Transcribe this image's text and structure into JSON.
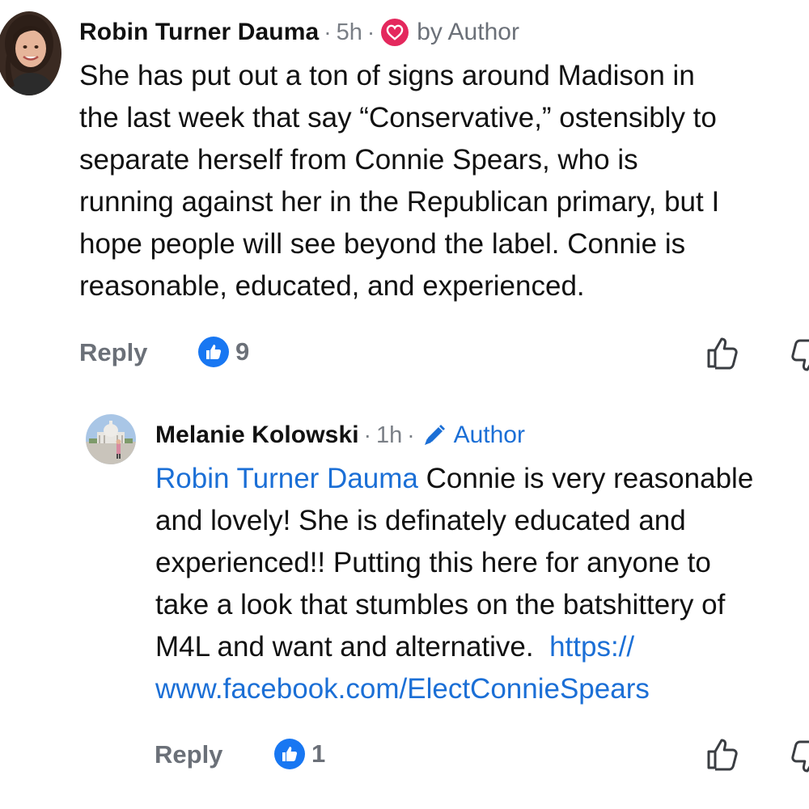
{
  "comments": [
    {
      "author": "Robin Turner Dauma",
      "separator": "·",
      "time": "5h",
      "badge_icon": "heart-icon",
      "badge_label": "by Author",
      "body_lines": [
        "She has put out a ton of signs around Madison in",
        "the last week that say “Conservative,” ostensibly to",
        "separate herself from Connie Spears, who is",
        "running against her in the Republican primary, but I",
        "hope people will see beyond the label. Connie is",
        "reasonable, educated, and experienced."
      ],
      "reply_label": "Reply",
      "like_count": "9"
    },
    {
      "author": "Melanie Kolowski",
      "separator": "·",
      "time": "1h",
      "badge_icon": "pencil-icon",
      "badge_label": "Author",
      "mention": "Robin Turner Dauma",
      "body_lines": [
        " Connie is very reasonable",
        "and lovely! She is definately educated and",
        "experienced!! Putting this here for anyone to",
        "take a look that stumbles on the batshittery of",
        "M4L and want and alternative.  "
      ],
      "link_lines": [
        "https://",
        "www.facebook.com/ElectConnieSpears"
      ],
      "reply_label": "Reply",
      "like_count": "1"
    }
  ],
  "colors": {
    "link_blue": "#1b6fd6",
    "meta_gray": "#6b7078",
    "heart_red": "#e4285d",
    "like_blue": "#1877f2"
  }
}
